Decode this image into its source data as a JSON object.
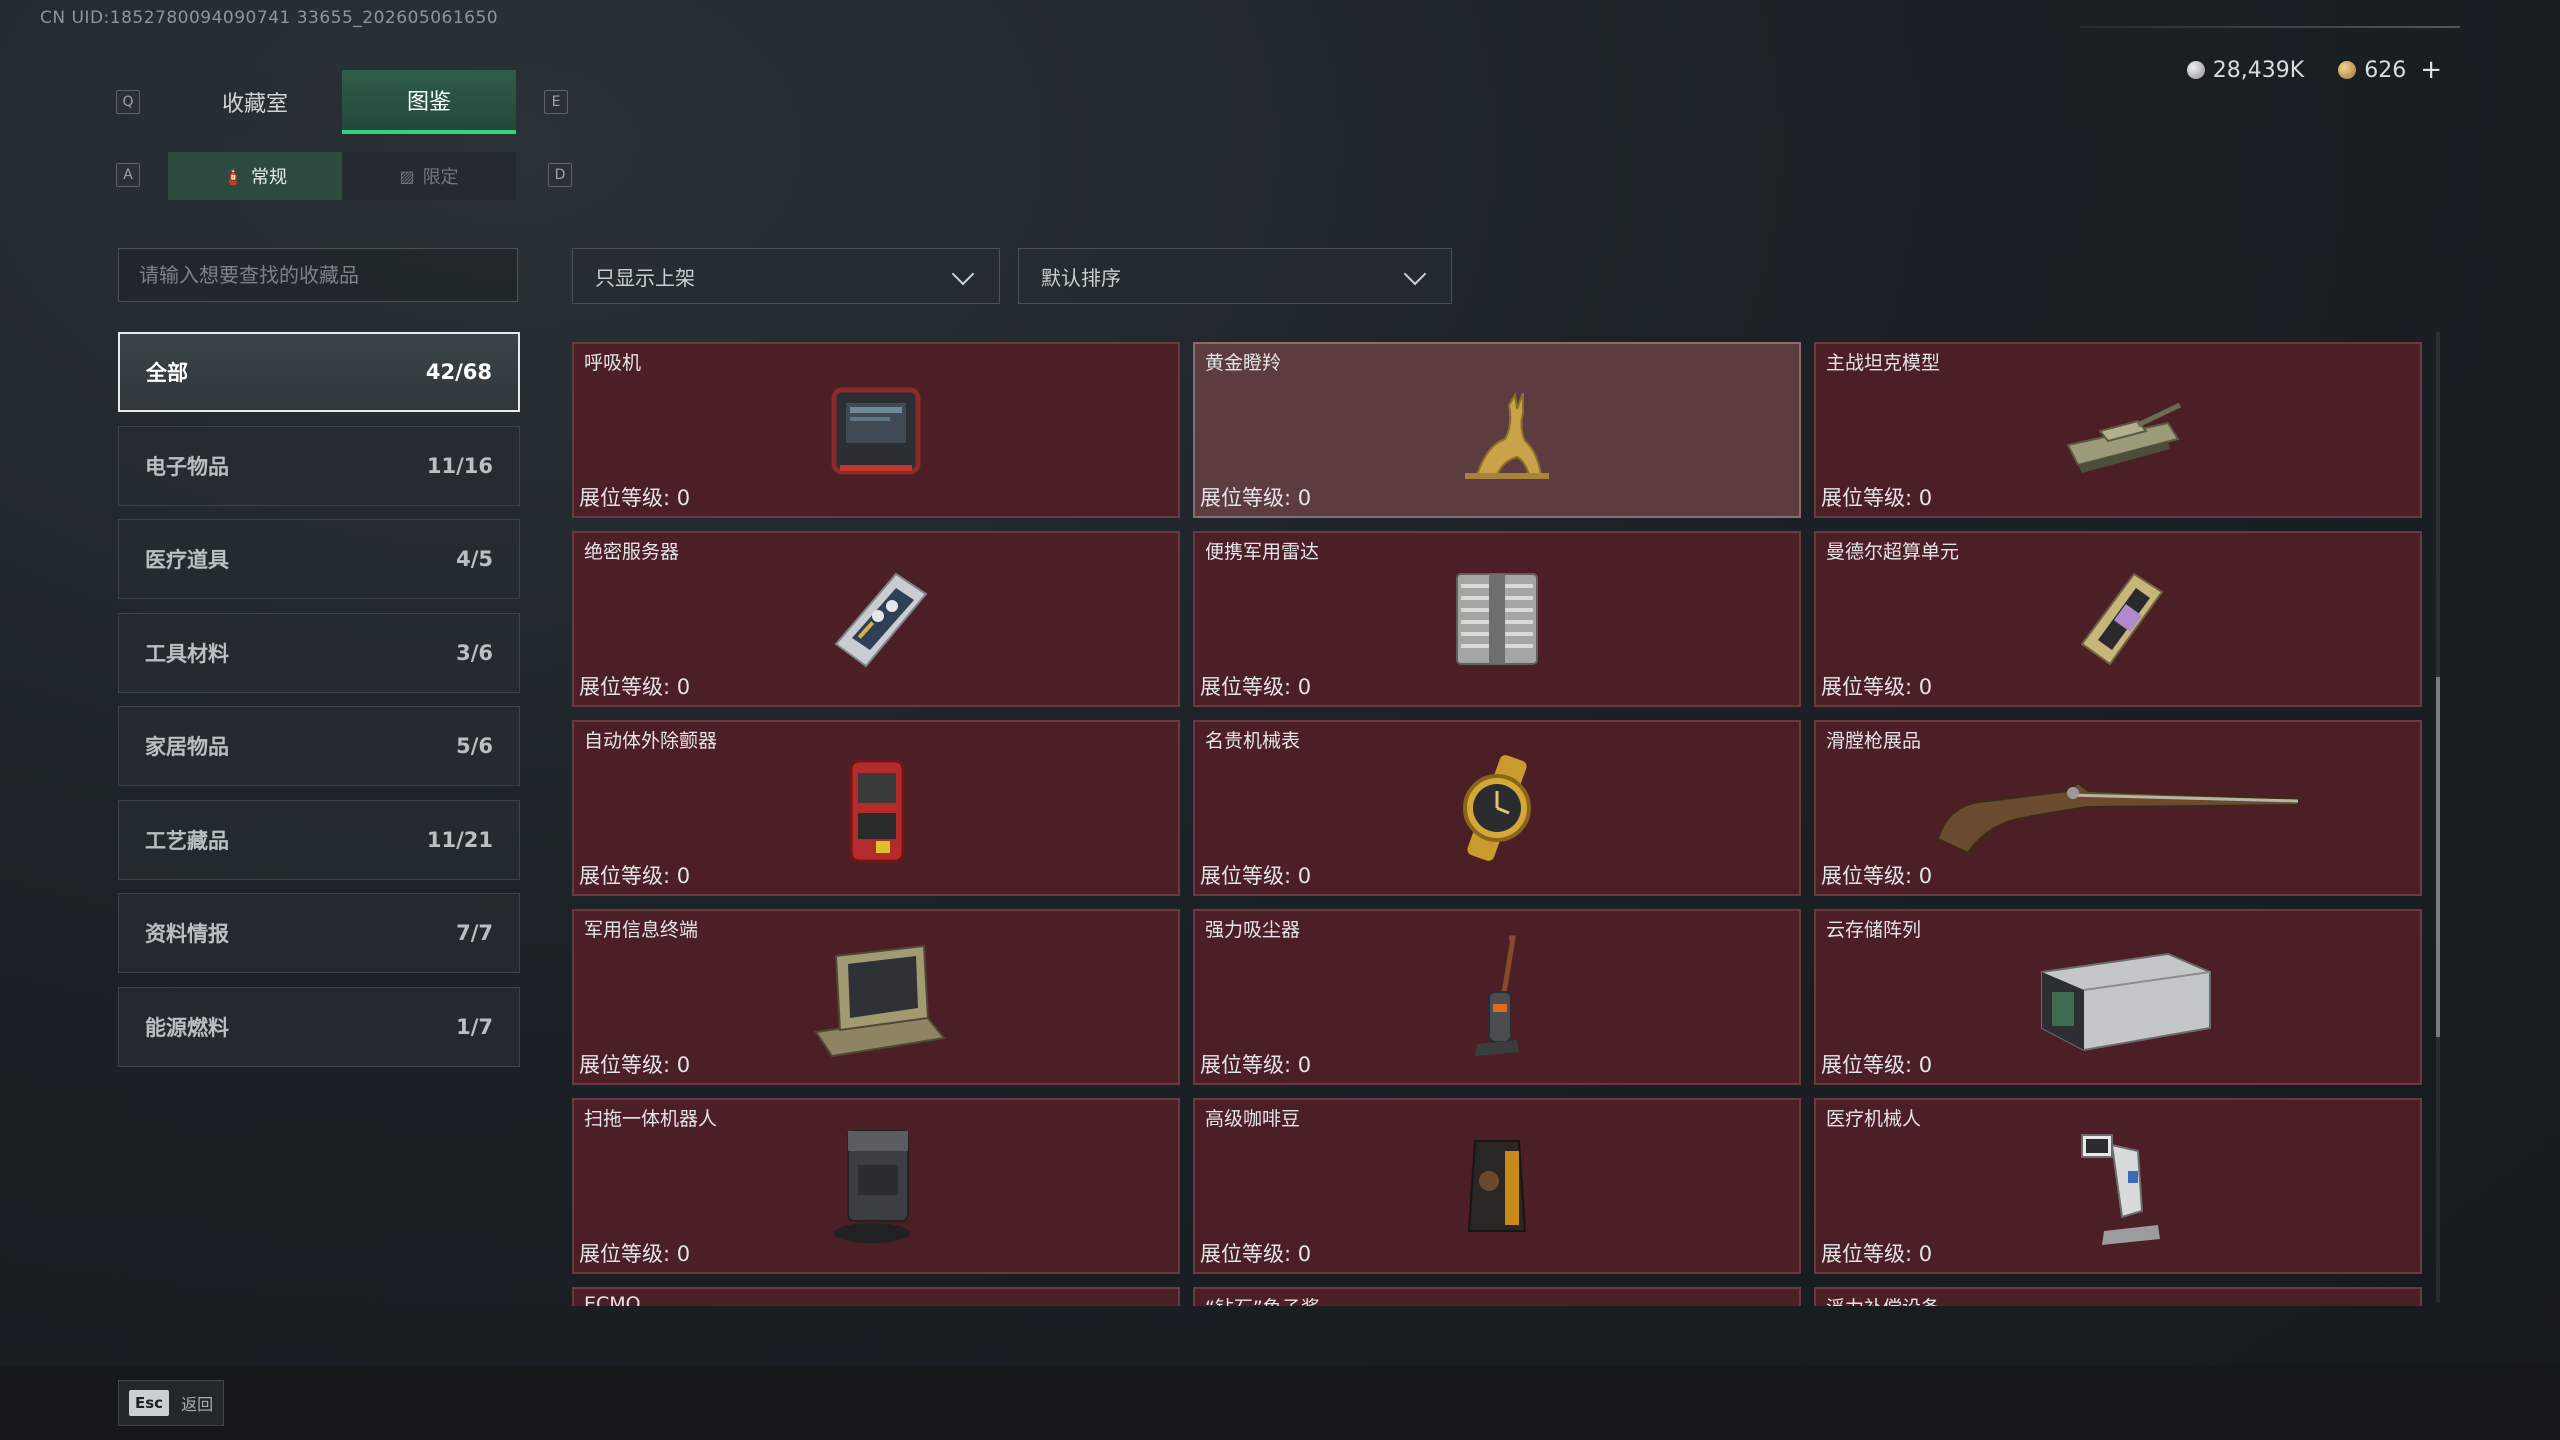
{
  "uid": "CN UID:1852780094090741 33655_202605061650",
  "currency": {
    "silver": "28,439K",
    "gold": "626",
    "add": "+"
  },
  "keys": {
    "prev_tab": "Q",
    "next_tab": "E",
    "prev_sub": "A",
    "next_sub": "D"
  },
  "tabs": [
    {
      "label": "收藏室",
      "active": false
    },
    {
      "label": "图鉴",
      "active": true
    }
  ],
  "subtabs": [
    {
      "label": "常规",
      "icon": "fire-extinguisher-icon",
      "glyph": "🧯",
      "active": true
    },
    {
      "label": "限定",
      "icon": "image-icon",
      "glyph": "▨",
      "active": false
    }
  ],
  "search": {
    "placeholder": "请输入想要查找的收藏品"
  },
  "filters": {
    "shelf": "只显示上架",
    "sort": "默认排序"
  },
  "categories": [
    {
      "label": "全部",
      "count": "42/68",
      "active": true
    },
    {
      "label": "电子物品",
      "count": "11/16"
    },
    {
      "label": "医疗道具",
      "count": "4/5"
    },
    {
      "label": "工具材料",
      "count": "3/6"
    },
    {
      "label": "家居物品",
      "count": "5/6"
    },
    {
      "label": "工艺藏品",
      "count": "11/21"
    },
    {
      "label": "资料情报",
      "count": "7/7"
    },
    {
      "label": "能源燃料",
      "count": "1/7"
    }
  ],
  "items": [
    {
      "name": "呼吸机",
      "level": "展位等级: 0",
      "icon": "ventilator-icon"
    },
    {
      "name": "黄金瞪羚",
      "level": "展位等级: 0",
      "icon": "golden-gazelle-icon",
      "highlight": true
    },
    {
      "name": "主战坦克模型",
      "level": "展位等级: 0",
      "icon": "tank-model-icon"
    },
    {
      "name": "绝密服务器",
      "level": "展位等级: 0",
      "icon": "server-icon"
    },
    {
      "name": "便携军用雷达",
      "level": "展位等级: 0",
      "icon": "radar-icon"
    },
    {
      "name": "曼德尔超算单元",
      "level": "展位等级: 0",
      "icon": "supercomputer-unit-icon"
    },
    {
      "name": "自动体外除颤器",
      "level": "展位等级: 0",
      "icon": "defibrillator-icon"
    },
    {
      "name": "名贵机械表",
      "level": "展位等级: 0",
      "icon": "watch-icon"
    },
    {
      "name": "滑膛枪展品",
      "level": "展位等级: 0",
      "icon": "musket-icon"
    },
    {
      "name": "军用信息终端",
      "level": "展位等级: 0",
      "icon": "military-terminal-icon"
    },
    {
      "name": "强力吸尘器",
      "level": "展位等级: 0",
      "icon": "vacuum-icon"
    },
    {
      "name": "云存储阵列",
      "level": "展位等级: 0",
      "icon": "storage-array-icon"
    },
    {
      "name": "扫拖一体机器人",
      "level": "展位等级: 0",
      "icon": "robot-vacuum-icon"
    },
    {
      "name": "高级咖啡豆",
      "level": "展位等级: 0",
      "icon": "coffee-beans-icon"
    },
    {
      "name": "医疗机械人",
      "level": "展位等级: 0",
      "icon": "medical-robot-icon"
    },
    {
      "name": "ECMO",
      "level": "",
      "icon": ""
    },
    {
      "name": "“钻石”鱼子酱",
      "level": "",
      "icon": ""
    },
    {
      "name": "浮力补偿设备",
      "level": "",
      "icon": ""
    }
  ],
  "footer": {
    "esc_key": "Esc",
    "back_label": "返回"
  },
  "colors": {
    "card_bg": "#4c1e25",
    "card_highlight_bg": "#5d3c40",
    "accent_green": "#34d17e",
    "active_tab_bg": "#2f5c48"
  }
}
